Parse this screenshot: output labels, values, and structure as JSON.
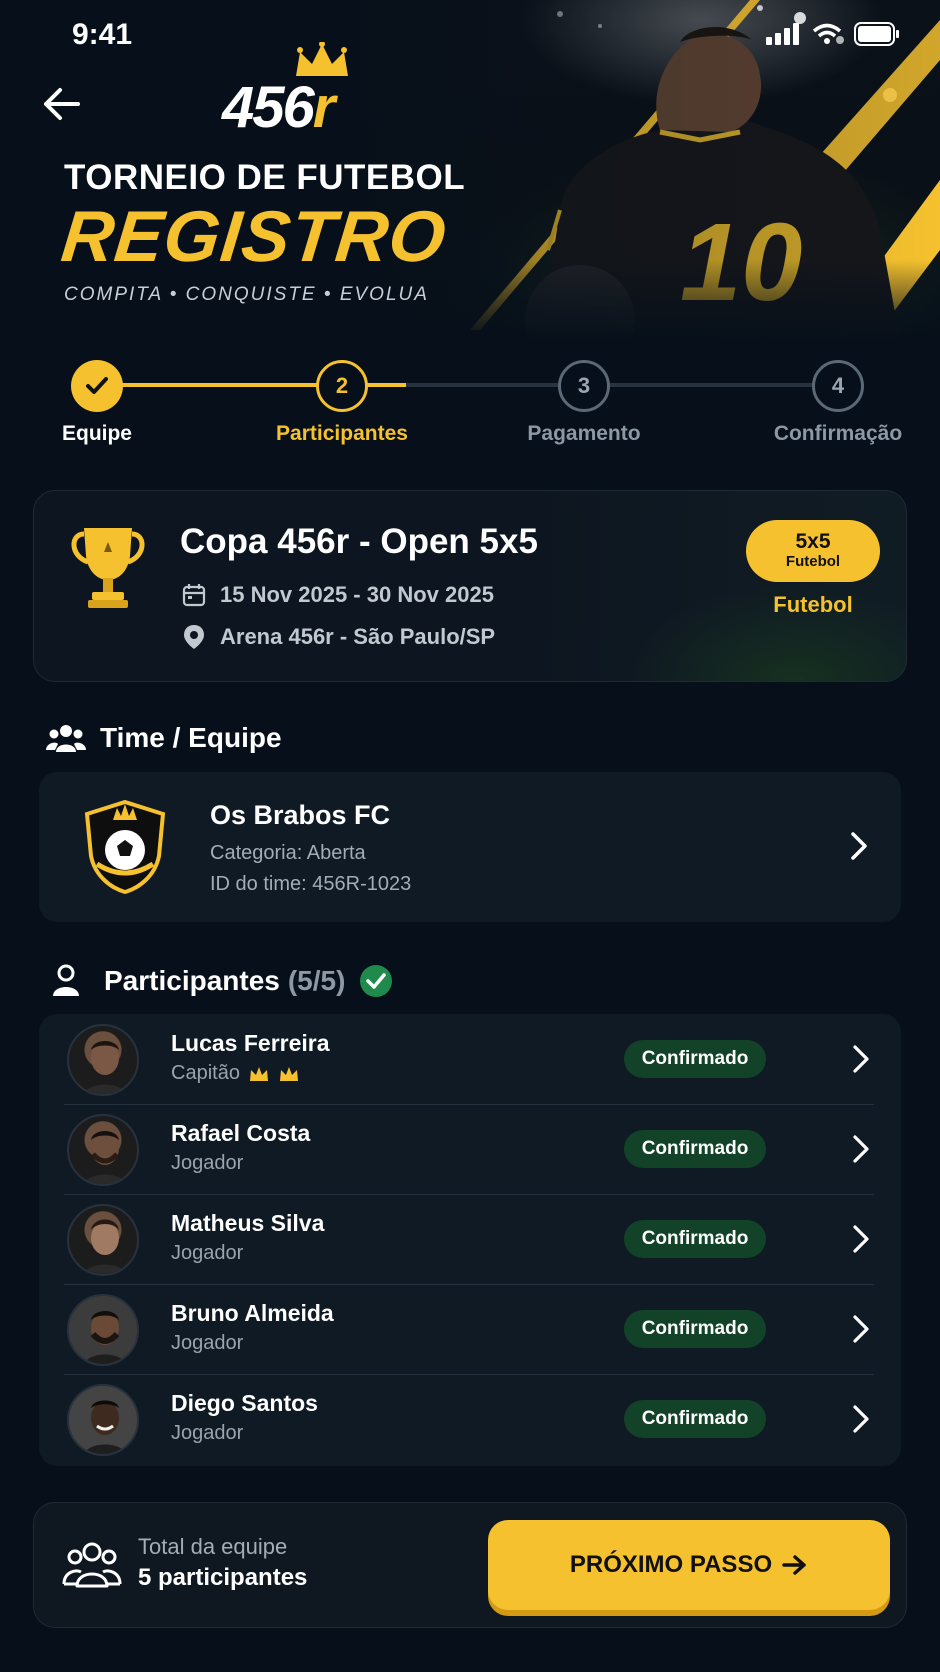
{
  "status_bar": {
    "time": "9:41"
  },
  "brand": {
    "logo_main": "456",
    "logo_r": "r"
  },
  "hero": {
    "title": "TORNEIO DE FUTEBOL",
    "headline": "REGISTRO",
    "tagline": "COMPITA  •  CONQUISTE  •  EVOLUA",
    "jersey_number": "10"
  },
  "stepper": {
    "current": 2,
    "steps": [
      {
        "number": "1",
        "label": "Equipe",
        "state": "done"
      },
      {
        "number": "2",
        "label": "Participantes",
        "state": "active"
      },
      {
        "number": "3",
        "label": "Pagamento",
        "state": "pending"
      },
      {
        "number": "4",
        "label": "Confirmação",
        "state": "pending"
      }
    ]
  },
  "event": {
    "title": "Copa 456r - Open 5x5",
    "dates": "15 Nov 2025 - 30 Nov 2025",
    "location": "Arena 456r - São Paulo/SP",
    "badge_format": "5x5",
    "badge_sport": "Futebol",
    "sport_label": "Futebol"
  },
  "team_section": {
    "heading": "Time / Equipe",
    "name": "Os Brabos FC",
    "category": "Categoria: Aberta",
    "team_id": "ID do time: 456R-1023"
  },
  "participants_section": {
    "heading": "Participantes",
    "count": "(5/5)",
    "participants": [
      {
        "name": "Lucas Ferreira",
        "role": "Capitão",
        "status": "Confirmado",
        "captain_icons": 2
      },
      {
        "name": "Rafael Costa",
        "role": "Jogador",
        "status": "Confirmado"
      },
      {
        "name": "Matheus Silva",
        "role": "Jogador",
        "status": "Confirmado"
      },
      {
        "name": "Bruno Almeida",
        "role": "Jogador",
        "status": "Confirmado"
      },
      {
        "name": "Diego Santos",
        "role": "Jogador",
        "status": "Confirmado"
      }
    ]
  },
  "footer": {
    "total_label": "Total da equipe",
    "total_value": "5 participantes",
    "next_button": "PRÓXIMO PASSO"
  },
  "colors": {
    "accent": "#f5c12e",
    "background": "#07101a",
    "card": "#0f1a24",
    "confirmed_pill": "#124227",
    "success": "#1f8a4c"
  },
  "icons": [
    "back-arrow-icon",
    "crown-icon",
    "signal-icon",
    "wifi-icon",
    "battery-icon",
    "check-icon",
    "trophy-icon",
    "calendar-icon",
    "location-pin-icon",
    "users-icon",
    "team-crest-icon",
    "user-icon",
    "check-circle-icon",
    "chevron-right-icon",
    "arrow-right-icon"
  ]
}
